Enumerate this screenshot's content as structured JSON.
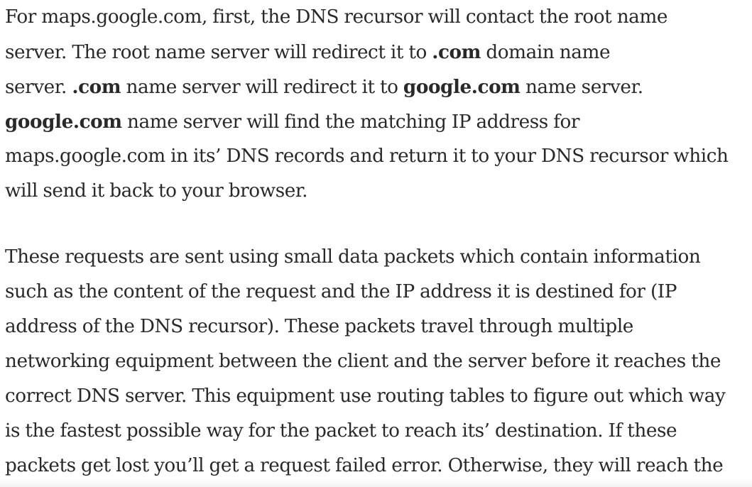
{
  "paragraph1": {
    "line1": [
      {
        "t": "For maps.google.com, first, the DNS recursor will contact the root name",
        "b": false
      }
    ],
    "line2": [
      {
        "t": "server. The root name server will redirect it to ",
        "b": false
      },
      {
        "t": ".com",
        "b": true
      },
      {
        "t": " domain name",
        "b": false
      }
    ],
    "line3": [
      {
        "t": "server. ",
        "b": false
      },
      {
        "t": ".com",
        "b": true
      },
      {
        "t": " name server will redirect it to ",
        "b": false
      },
      {
        "t": "google.com",
        "b": true
      },
      {
        "t": " name server.",
        "b": false
      }
    ],
    "line4": [
      {
        "t": "google.com",
        "b": true
      },
      {
        "t": " name server will find the matching IP address for",
        "b": false
      }
    ],
    "line5": [
      {
        "t": "maps.google.com in its’ DNS records and return it to your DNS recursor which",
        "b": false
      }
    ],
    "line6": [
      {
        "t": "will send it back to your browser.",
        "b": false
      }
    ]
  },
  "paragraph2": {
    "lines": [
      "These requests are sent using small data packets which contain information",
      "such as the content of the request and the IP address it is destined for (IP",
      "address of the DNS recursor). These packets travel through multiple",
      "networking equipment between the client and the server before it reaches the",
      "correct DNS server. This equipment use routing tables to figure out which way",
      "is the fastest possible way for the packet to reach its’ destination. If these",
      "packets get lost you’ll get a request failed error. Otherwise, they will reach the"
    ]
  }
}
